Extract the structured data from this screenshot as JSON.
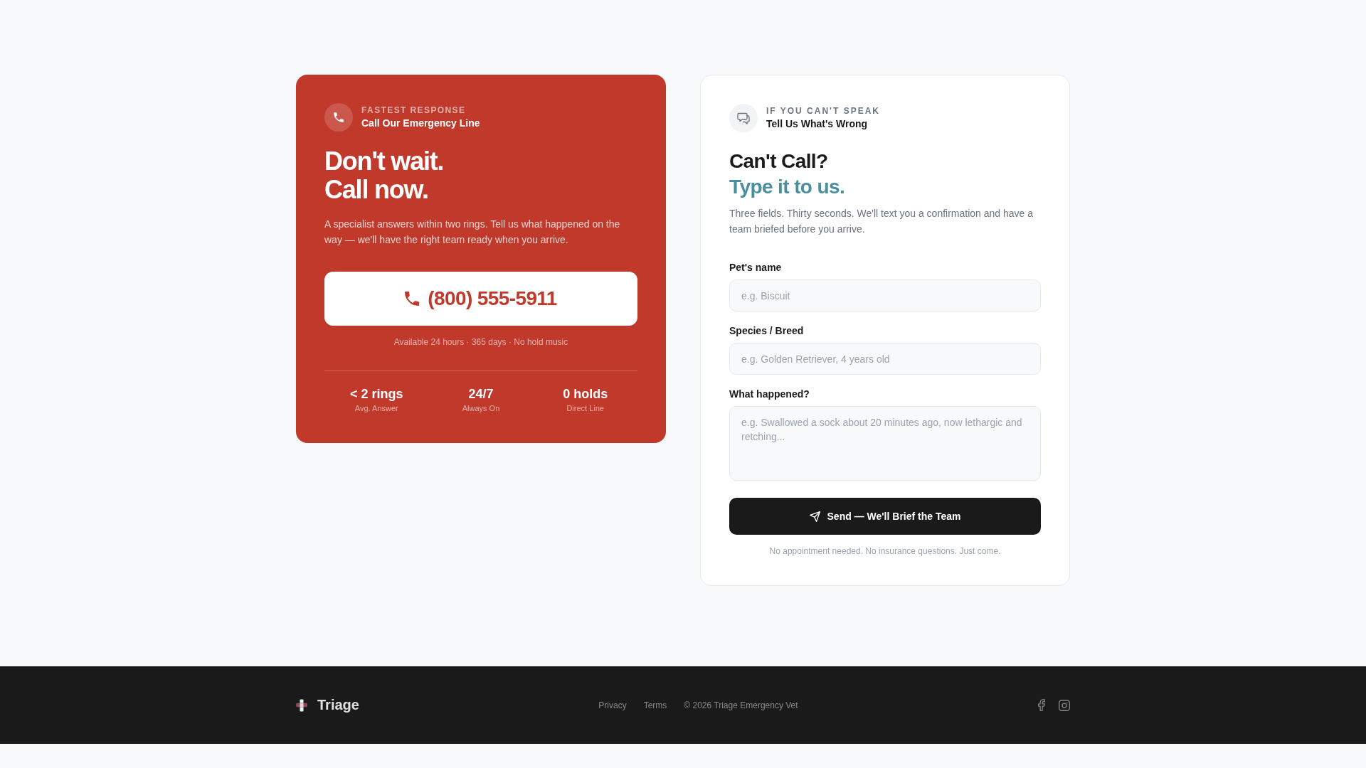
{
  "call_card": {
    "eyebrow": "FASTEST RESPONSE",
    "subtitle": "Call Our Emergency Line",
    "headline": [
      "Don't wait.",
      "Call now."
    ],
    "description": "A specialist answers within two rings. Tell us what happened on the way — we'll have the right team ready when you arrive.",
    "phone_button": "(800) 555-5911",
    "availability": "Available 24 hours · 365 days · No hold music",
    "stats": [
      {
        "value": "< 2 rings",
        "label": "Avg. Answer"
      },
      {
        "value": "24/7",
        "label": "Always On"
      },
      {
        "value": "0 holds",
        "label": "Direct Line"
      }
    ]
  },
  "message_card": {
    "eyebrow": "IF YOU CAN'T SPEAK",
    "subtitle": "Tell Us What's Wrong",
    "headline": "Can't Call?",
    "headline_accent": "Type it to us.",
    "description": "Three fields. Thirty seconds. We'll text you a confirmation and have a team briefed before you arrive.",
    "fields": [
      {
        "kind": "input",
        "label": "Pet's name",
        "placeholder": "e.g. Biscuit"
      },
      {
        "kind": "input",
        "label": "Species / Breed",
        "placeholder": "e.g. Golden Retriever, 4 years old"
      },
      {
        "kind": "textarea",
        "label": "What happened?",
        "placeholder": "e.g. Swallowed a sock about 20 minutes ago, now lethargic and retching..."
      }
    ],
    "submit_button": "Send — We'll Brief the Team",
    "note": "No appointment needed. No insurance questions. Just come."
  },
  "footer": {
    "brand": "Triage",
    "links": [
      "Privacy",
      "Terms"
    ],
    "copyright": "© 2026 Triage Emergency Vet"
  }
}
